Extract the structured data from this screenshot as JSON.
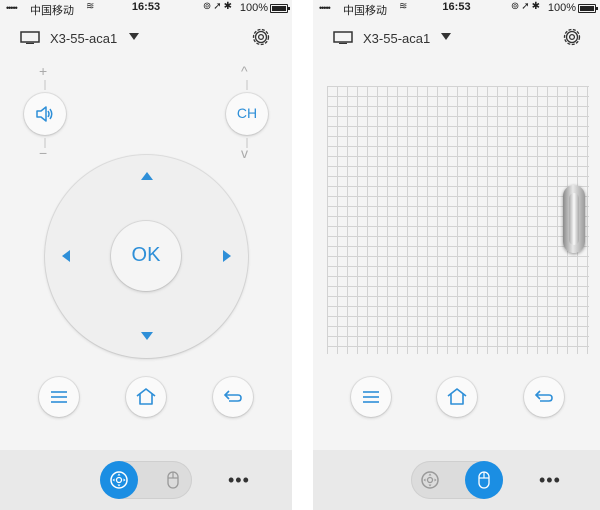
{
  "status_bar": {
    "signal": "•••••",
    "carrier": "中国移动",
    "time": "16:53",
    "battery_text": "100%",
    "battery_level": 1.0
  },
  "header": {
    "device_name": "X3-55-aca1"
  },
  "remote": {
    "volume_plus": "+",
    "volume_minus": "−",
    "channel_label": "CH",
    "channel_up": "^",
    "channel_down": "v",
    "ok_label": "OK"
  },
  "bottom_bar": {
    "more_label": "•••"
  },
  "colors": {
    "accent": "#2e8fd8",
    "toggle_active": "#1b8ee3"
  },
  "icons": [
    "tv-icon",
    "caret-down-icon",
    "gear-icon",
    "volume-icon",
    "menu-icon",
    "home-icon",
    "back-icon",
    "dpad-icon",
    "mouse-icon",
    "more-icon"
  ]
}
